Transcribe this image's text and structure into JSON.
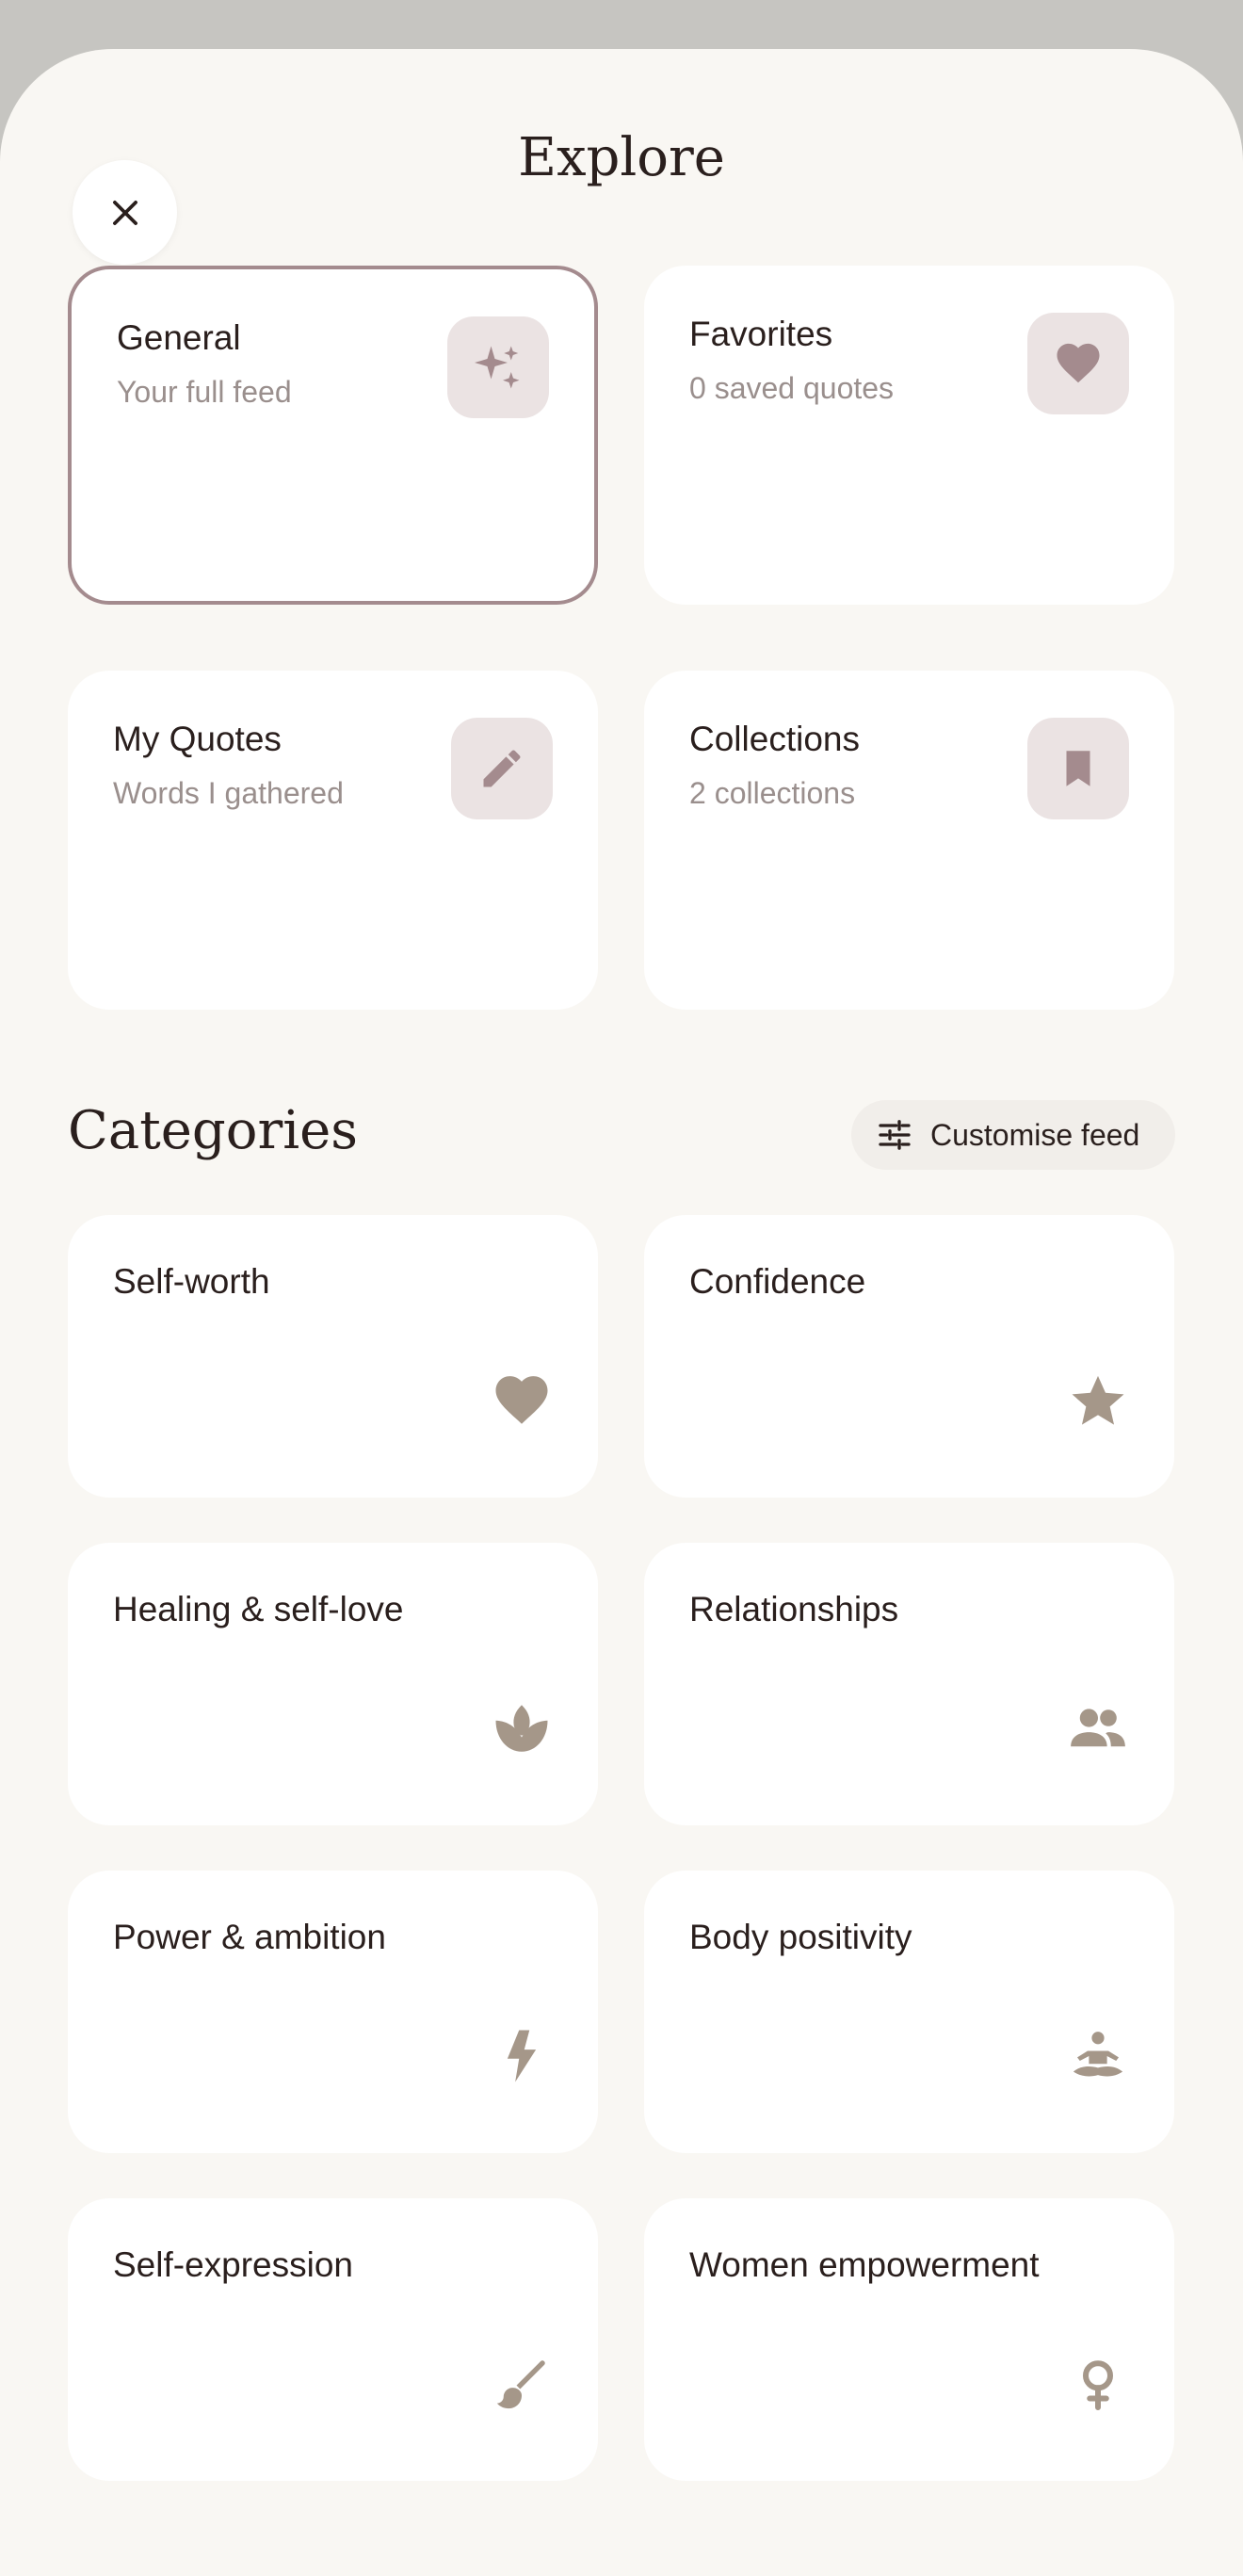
{
  "header": {
    "title": "Explore"
  },
  "feeds": [
    {
      "title": "General",
      "subtitle": "Your full feed",
      "icon": "sparkle-icon",
      "selected": true
    },
    {
      "title": "Favorites",
      "subtitle": "0 saved quotes",
      "icon": "heart-icon",
      "selected": false
    },
    {
      "title": "My Quotes",
      "subtitle": "Words I gathered",
      "icon": "pencil-icon",
      "selected": false
    },
    {
      "title": "Collections",
      "subtitle": "2 collections",
      "icon": "bookmark-icon",
      "selected": false
    }
  ],
  "categories_section": {
    "title": "Categories",
    "customise_label": "Customise feed"
  },
  "categories": [
    {
      "label": "Self-worth",
      "icon": "heart-icon"
    },
    {
      "label": "Confidence",
      "icon": "star-icon"
    },
    {
      "label": "Healing & self-love",
      "icon": "lotus-icon"
    },
    {
      "label": "Relationships",
      "icon": "people-icon"
    },
    {
      "label": "Power & ambition",
      "icon": "lightning-icon"
    },
    {
      "label": "Body positivity",
      "icon": "meditation-icon"
    },
    {
      "label": "Self-expression",
      "icon": "brush-icon"
    },
    {
      "label": "Women empowerment",
      "icon": "female-symbol-icon"
    }
  ],
  "colors": {
    "accent_icon": "#a48b8e",
    "category_icon": "#a59789",
    "selected_border": "#a48b8e",
    "background": "#f9f7f3"
  }
}
